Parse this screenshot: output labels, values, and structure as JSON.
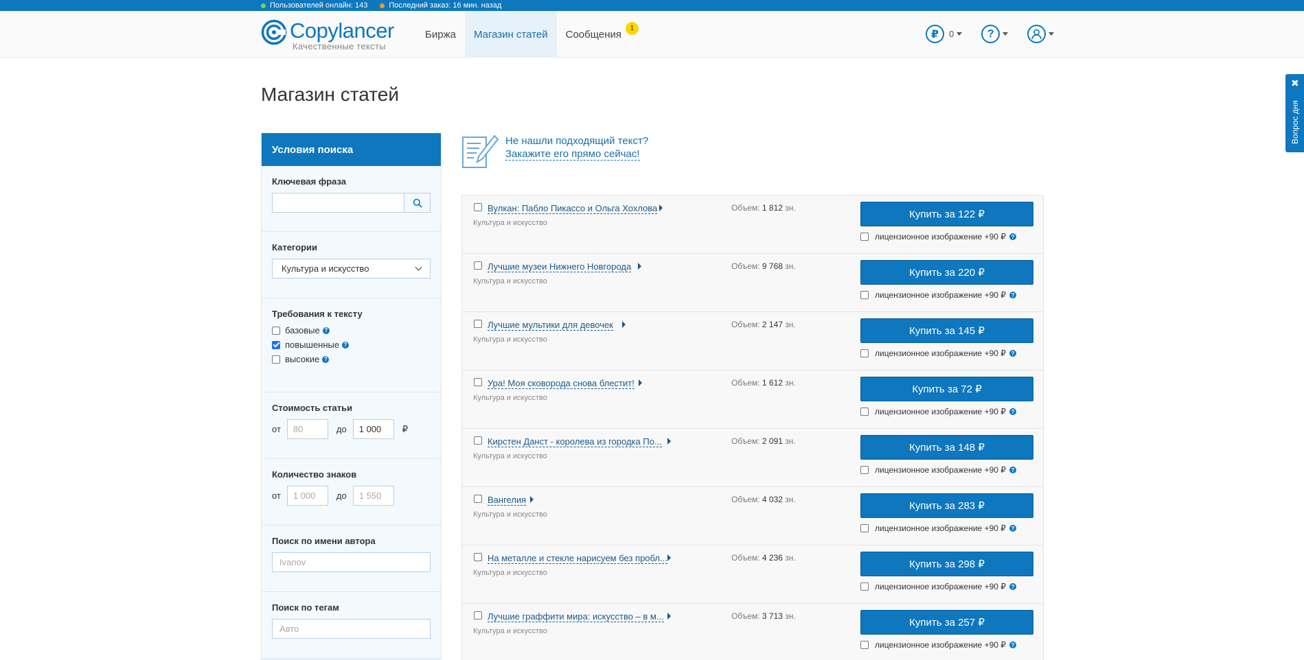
{
  "status": {
    "online_label": "Пользователей онлайн: 143",
    "last_order_label": "Последний заказ: 16 мин. назад"
  },
  "header": {
    "logo_text": "Copylancer",
    "logo_sub": "Качественные тексты",
    "nav": [
      {
        "label": "Биржа"
      },
      {
        "label": "Магазин статей"
      },
      {
        "label": "Сообщения",
        "badge": "1"
      }
    ],
    "balance": "0",
    "currency_symbol": "₽",
    "help_symbol": "?"
  },
  "page": {
    "title": "Магазин статей"
  },
  "sidebar": {
    "title": "Условия поиска",
    "keyword_label": "Ключевая фраза",
    "keyword_value": "",
    "categories_label": "Категории",
    "category_selected": "Культура и искусство",
    "requirements_label": "Требования к тексту",
    "requirements": [
      {
        "label": "базовые",
        "checked": false
      },
      {
        "label": "повышенные",
        "checked": true
      },
      {
        "label": "высокие",
        "checked": false
      }
    ],
    "price_label": "Стоимость статьи",
    "price_from_label": "от",
    "price_from_placeholder": "80",
    "price_to_label": "до",
    "price_to_value": "1 000",
    "price_currency": "₽",
    "chars_label": "Количество знаков",
    "chars_from_label": "от",
    "chars_from_placeholder": "1 000",
    "chars_to_label": "до",
    "chars_to_placeholder": "1 550",
    "author_label": "Поиск по имени автора",
    "author_placeholder": "Ivanov",
    "tags_label": "Поиск по тегам",
    "tags_placeholder": "Авто"
  },
  "prompt": {
    "question": "Не нашли подходящий текст?",
    "link": "Закажите его прямо сейчас!"
  },
  "articles": [
    {
      "title": "Вулкан: Пабло Пикассо и Ольга Хохлова",
      "category": "Культура и искусство",
      "volume_label": "Объем:",
      "volume": "1 812",
      "unit": "зн.",
      "buy": "Купить за 122 ₽",
      "license": "лицензионное изображение +90 ₽"
    },
    {
      "title": "Лучшие музеи Нижнего Новгорода",
      "category": "Культура и искусство",
      "volume_label": "Объем:",
      "volume": "9 768",
      "unit": "зн.",
      "buy": "Купить за 220 ₽",
      "license": "лицензионное изображение +90 ₽"
    },
    {
      "title": "Лучшие мультики для девочек",
      "category": "Культура и искусство",
      "volume_label": "Объем:",
      "volume": "2 147",
      "unit": "зн.",
      "buy": "Купить за 145 ₽",
      "license": "лицензионное изображение +90 ₽"
    },
    {
      "title": "Ура! Моя сковорода снова блестит!",
      "category": "Культура и искусство",
      "volume_label": "Объем:",
      "volume": "1 612",
      "unit": "зн.",
      "buy": "Купить за 72 ₽",
      "license": "лицензионное изображение +90 ₽"
    },
    {
      "title": "Кирстен Данст - королева из городка По...",
      "category": "Культура и искусство",
      "volume_label": "Объем:",
      "volume": "2 091",
      "unit": "зн.",
      "buy": "Купить за 148 ₽",
      "license": "лицензионное изображение +90 ₽"
    },
    {
      "title": "Вангелия",
      "category": "Культура и искусство",
      "volume_label": "Объем:",
      "volume": "4 032",
      "unit": "зн.",
      "buy": "Купить за 283 ₽",
      "license": "лицензионное изображение +90 ₽"
    },
    {
      "title": "На металле и стекле нарисуем без пробл...",
      "category": "Культура и искусство",
      "volume_label": "Объем:",
      "volume": "4 236",
      "unit": "зн.",
      "buy": "Купить за 298 ₽",
      "license": "лицензионное изображение +90 ₽"
    },
    {
      "title": "Лучшие граффити мира: искусство – в м...",
      "category": "Культура и искусство",
      "volume_label": "Объем:",
      "volume": "3 713",
      "unit": "зн.",
      "buy": "Купить за 257 ₽",
      "license": "лицензионное изображение +90 ₽"
    }
  ],
  "side_tab": {
    "label": "Вопрос дня",
    "close": "✖"
  },
  "colors": {
    "brand": "#0e77be",
    "badge": "#ffd400",
    "online_dot": "#6cd36c",
    "order_dot": "#f59a23"
  }
}
